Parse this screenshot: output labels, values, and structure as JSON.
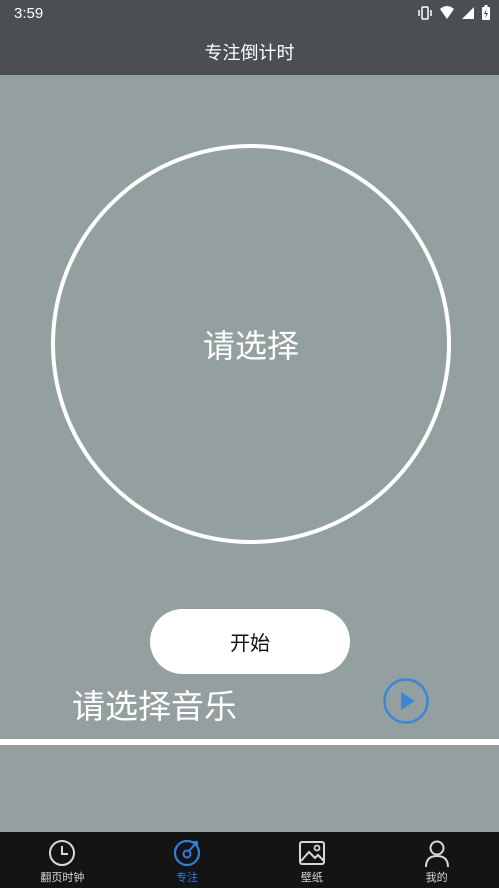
{
  "status_bar": {
    "time": "3:59"
  },
  "app_bar": {
    "title": "专注倒计时"
  },
  "timer": {
    "label": "请选择"
  },
  "start_button": {
    "label": "开始"
  },
  "music": {
    "label": "请选择音乐"
  },
  "colors": {
    "header_bg": "#4b4f53",
    "content_bg": "#94a09f",
    "tab_bar_bg": "#141414",
    "accent": "#2f7ee0",
    "play_icon": "#3b86d6"
  },
  "tabs": [
    {
      "label": "翻页时钟",
      "icon": "clock-icon",
      "active": false
    },
    {
      "label": "专注",
      "icon": "focus-icon",
      "active": true
    },
    {
      "label": "壁纸",
      "icon": "image-icon",
      "active": false
    },
    {
      "label": "我的",
      "icon": "person-icon",
      "active": false
    }
  ]
}
